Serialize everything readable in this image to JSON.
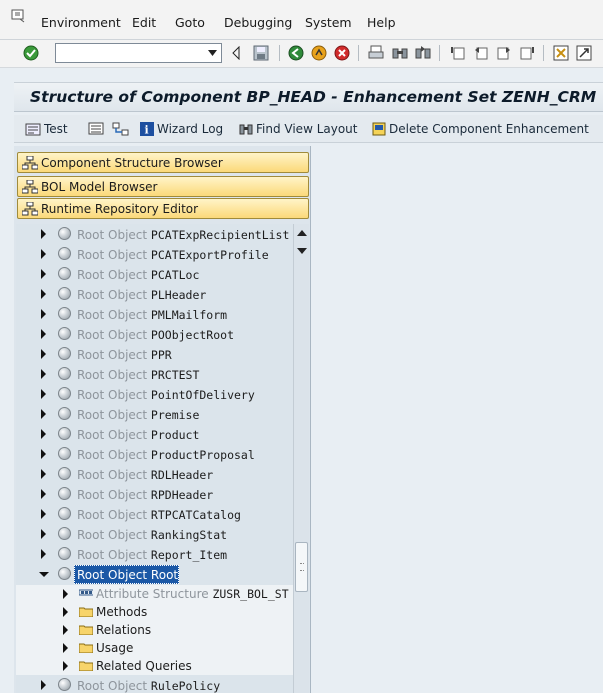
{
  "menu": [
    "Environment",
    "Edit",
    "Goto",
    "Debugging",
    "System",
    "Help"
  ],
  "toolbar": {
    "command_value": ""
  },
  "title": "Structure of Component BP_HEAD - Enhancement Set ZENH_CRM",
  "app_toolbar": {
    "test": "Test",
    "wizard_log": "Wizard Log",
    "find_view_layout": "Find View Layout",
    "delete_enhancement": "Delete Component Enhancement"
  },
  "browsers": [
    "Component Structure Browser",
    "BOL Model Browser",
    "Runtime Repository Editor"
  ],
  "tree": {
    "prefix": "Root Object",
    "items": [
      "PCATExpRecipientList",
      "PCATExportProfile",
      "PCATLoc",
      "PLHeader",
      "PMLMailform",
      "POObjectRoot",
      "PPR",
      "PRCTEST",
      "PointOfDelivery",
      "Premise",
      "Product",
      "ProductProposal",
      "RDLHeader",
      "RPDHeader",
      "RTPCATCatalog",
      "RankingStat",
      "Report_Item"
    ],
    "selected": "Root",
    "children": {
      "attribute_prefix": "Attribute Structure",
      "attribute_name": "ZUSR_BOL_ST",
      "folders": [
        "Methods",
        "Relations",
        "Usage",
        "Related Queries"
      ]
    },
    "last": "RulePolicy"
  },
  "colors": {
    "selection": "#1b58a6",
    "button_yellow": "#fbd97a"
  }
}
